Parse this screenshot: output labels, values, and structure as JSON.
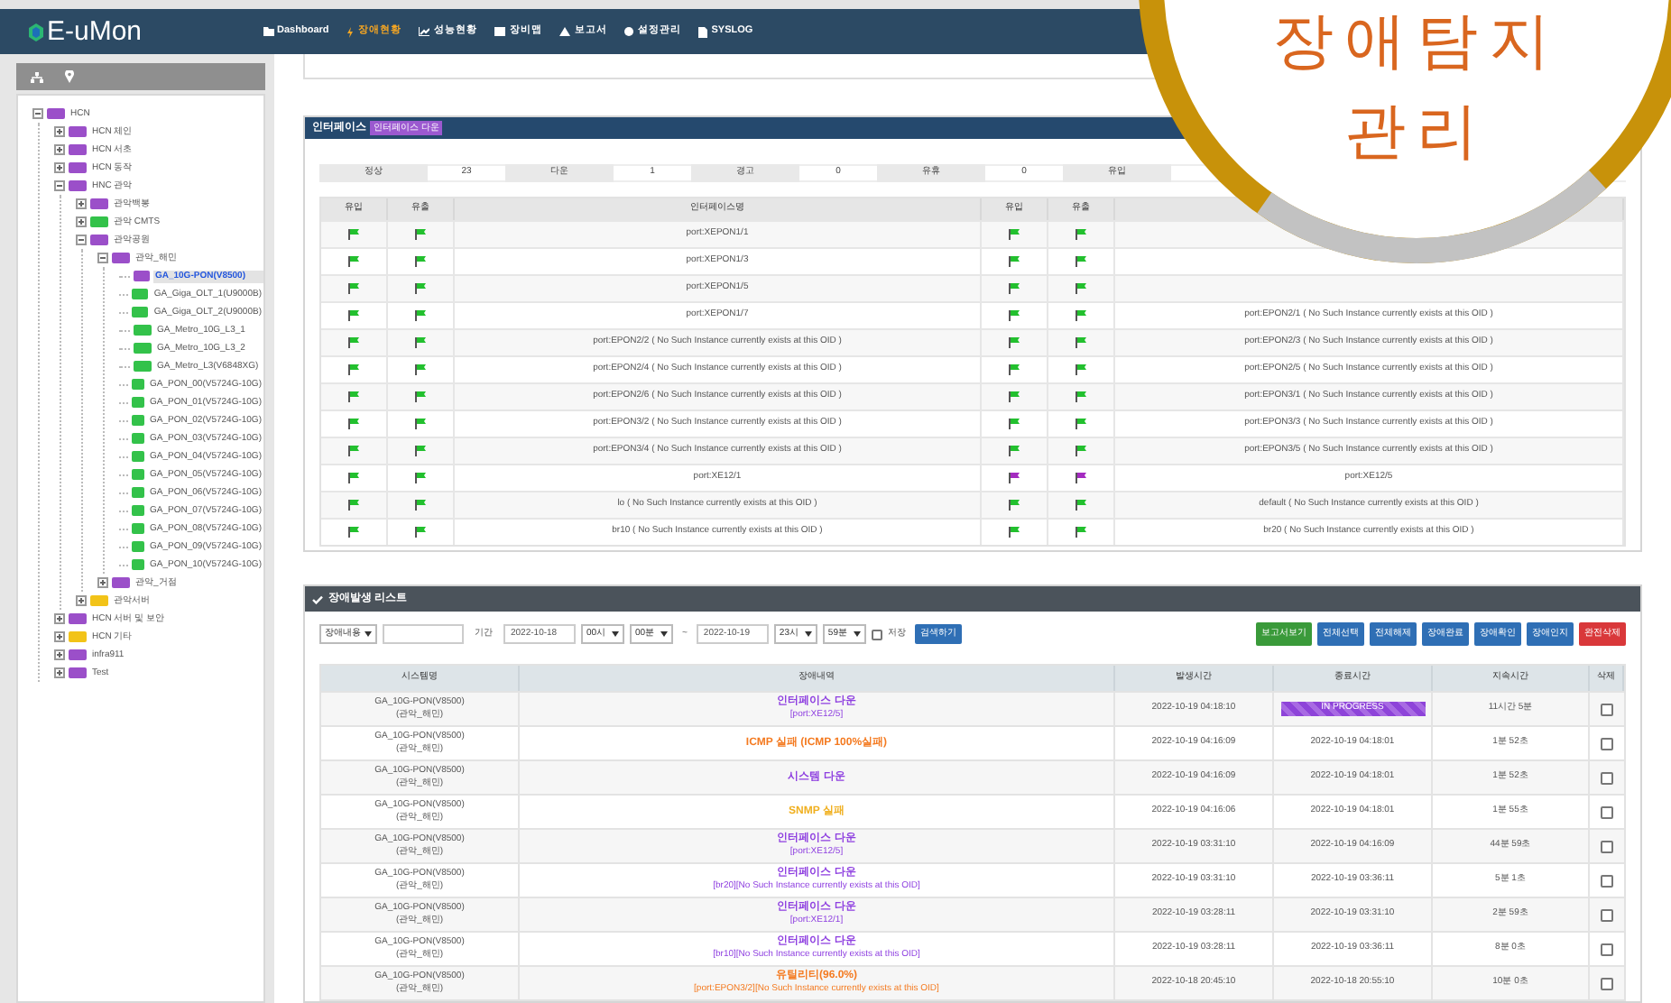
{
  "nav": {
    "logo": "E-uMon",
    "items": [
      {
        "label": "Dashboard",
        "selected": false
      },
      {
        "label": "장애현황",
        "selected": true
      },
      {
        "label": "성능현황",
        "selected": false
      },
      {
        "label": "장비맵",
        "selected": false
      },
      {
        "label": "보고서",
        "selected": false
      },
      {
        "label": "설정관리",
        "selected": false
      },
      {
        "label": "SYSLOG",
        "selected": false
      }
    ]
  },
  "callout": {
    "lines": [
      "장애탐지",
      "관리"
    ]
  },
  "tree": [
    {
      "label": "HCN",
      "color": "#9b4fc9",
      "expanded": true,
      "selected": false,
      "children": [
        {
          "label": "HCN 체인",
          "color": "#9b4fc9",
          "expanded": false,
          "selected": false
        },
        {
          "label": "HCN 서초",
          "color": "#9b4fc9",
          "expanded": false,
          "selected": false
        },
        {
          "label": "HCN 동작",
          "color": "#9b4fc9",
          "expanded": false,
          "selected": false
        },
        {
          "label": "HNC 관악",
          "color": "#9b4fc9",
          "expanded": true,
          "selected": false,
          "children": [
            {
              "label": "관악백봉",
              "color": "#9b4fc9",
              "expanded": false,
              "selected": false
            },
            {
              "label": "관악 CMTS",
              "color": "#33c24a",
              "expanded": false,
              "selected": false
            },
            {
              "label": "관악공원",
              "color": "#9b4fc9",
              "expanded": true,
              "selected": false,
              "children": [
                {
                  "label": "관악_해민",
                  "color": "#9b4fc9",
                  "expanded": true,
                  "selected": false,
                  "children": [
                    {
                      "label": "GA_10G-PON(V8500)",
                      "color": "#9b4fc9",
                      "selected": true
                    },
                    {
                      "label": "GA_Giga_OLT_1(U9000B)",
                      "color": "#33c24a",
                      "selected": false
                    },
                    {
                      "label": "GA_Giga_OLT_2(U9000B)",
                      "color": "#33c24a",
                      "selected": false
                    },
                    {
                      "label": "GA_Metro_10G_L3_1",
                      "color": "#33c24a",
                      "selected": false
                    },
                    {
                      "label": "GA_Metro_10G_L3_2",
                      "color": "#33c24a",
                      "selected": false
                    },
                    {
                      "label": "GA_Metro_L3(V6848XG)",
                      "color": "#33c24a",
                      "selected": false
                    },
                    {
                      "label": "GA_PON_00(V5724G-10G)",
                      "color": "#33c24a",
                      "selected": false
                    },
                    {
                      "label": "GA_PON_01(V5724G-10G)",
                      "color": "#33c24a",
                      "selected": false
                    },
                    {
                      "label": "GA_PON_02(V5724G-10G)",
                      "color": "#33c24a",
                      "selected": false
                    },
                    {
                      "label": "GA_PON_03(V5724G-10G)",
                      "color": "#33c24a",
                      "selected": false
                    },
                    {
                      "label": "GA_PON_04(V5724G-10G)",
                      "color": "#33c24a",
                      "selected": false
                    },
                    {
                      "label": "GA_PON_05(V5724G-10G)",
                      "color": "#33c24a",
                      "selected": false
                    },
                    {
                      "label": "GA_PON_06(V5724G-10G)",
                      "color": "#33c24a",
                      "selected": false
                    },
                    {
                      "label": "GA_PON_07(V5724G-10G)",
                      "color": "#33c24a",
                      "selected": false
                    },
                    {
                      "label": "GA_PON_08(V5724G-10G)",
                      "color": "#33c24a",
                      "selected": false
                    },
                    {
                      "label": "GA_PON_09(V5724G-10G)",
                      "color": "#33c24a",
                      "selected": false
                    },
                    {
                      "label": "GA_PON_10(V5724G-10G)",
                      "color": "#33c24a",
                      "selected": false
                    }
                  ]
                },
                {
                  "label": "관악_거점",
                  "color": "#9b4fc9",
                  "expanded": false,
                  "selected": false
                }
              ]
            },
            {
              "label": "관악서버",
              "color": "#f2c318",
              "expanded": false,
              "selected": false
            }
          ]
        },
        {
          "label": "HCN 서버 및 보안",
          "color": "#9b4fc9",
          "expanded": false,
          "selected": false
        },
        {
          "label": "HCN 기타",
          "color": "#f2c318",
          "expanded": false,
          "selected": false
        },
        {
          "label": "infra911",
          "color": "#9b4fc9",
          "expanded": false,
          "selected": false
        },
        {
          "label": "Test",
          "color": "#9b4fc9",
          "expanded": false,
          "selected": false
        }
      ]
    }
  ],
  "interfaces": {
    "title": "인터페이스",
    "badge": "인터페이스 다운",
    "summary": [
      {
        "label": "정상",
        "value": "23"
      },
      {
        "label": "다운",
        "value": "1"
      },
      {
        "label": "경고",
        "value": "0"
      },
      {
        "label": "유휴",
        "value": "0"
      },
      {
        "label": "유입"
      }
    ],
    "columns": [
      "유입",
      "유출",
      "인터페이스명",
      "유입",
      "유출"
    ],
    "rows": [
      {
        "in_ok": true,
        "out_ok": true,
        "name": "port:XEPON1/1",
        "in2_ok": true,
        "out2_ok": true
      },
      {
        "in_ok": true,
        "out_ok": true,
        "name": "port:XEPON1/3",
        "in2_ok": true,
        "out2_ok": true
      },
      {
        "in_ok": true,
        "out_ok": true,
        "name": "port:XEPON1/5",
        "in2_ok": true,
        "out2_ok": true
      },
      {
        "in_ok": true,
        "out_ok": true,
        "name": "port:XEPON1/7",
        "in2_ok": true,
        "out2_ok": true,
        "name2": "port:EPON2/1 ( No Such Instance currently exists at this OID )"
      },
      {
        "in_ok": true,
        "out_ok": true,
        "name": "port:EPON2/2 ( No Such Instance currently exists at this OID )",
        "in2_ok": true,
        "out2_ok": true,
        "name2": "port:EPON2/3 ( No Such Instance currently exists at this OID )"
      },
      {
        "in_ok": true,
        "out_ok": true,
        "name": "port:EPON2/4 ( No Such Instance currently exists at this OID )",
        "in2_ok": true,
        "out2_ok": true,
        "name2": "port:EPON2/5 ( No Such Instance currently exists at this OID )"
      },
      {
        "in_ok": true,
        "out_ok": true,
        "name": "port:EPON2/6 ( No Such Instance currently exists at this OID )",
        "in2_ok": true,
        "out2_ok": true,
        "name2": "port:EPON3/1 ( No Such Instance currently exists at this OID )"
      },
      {
        "in_ok": true,
        "out_ok": true,
        "name": "port:EPON3/2 ( No Such Instance currently exists at this OID )",
        "in2_ok": true,
        "out2_ok": true,
        "name2": "port:EPON3/3 ( No Such Instance currently exists at this OID )"
      },
      {
        "in_ok": true,
        "out_ok": true,
        "name": "port:EPON3/4 ( No Such Instance currently exists at this OID )",
        "in2_ok": true,
        "out2_ok": true,
        "name2": "port:EPON3/5 ( No Such Instance currently exists at this OID )"
      },
      {
        "in_ok": true,
        "out_ok": true,
        "name": "port:XE12/1",
        "in2_ok": false,
        "out2_ok": false,
        "name2": "port:XE12/5"
      },
      {
        "in_ok": true,
        "out_ok": true,
        "name": "lo ( No Such Instance currently exists at this OID )",
        "in2_ok": true,
        "out2_ok": true,
        "name2": "default ( No Such Instance currently exists at this OID )"
      },
      {
        "in_ok": true,
        "out_ok": true,
        "name": "br10 ( No Such Instance currently exists at this OID )",
        "in2_ok": true,
        "out2_ok": true,
        "name2": "br20 ( No Such Instance currently exists at this OID )"
      }
    ]
  },
  "faults": {
    "title": "장애발생 리스트",
    "filter": {
      "type_select": "장애내용",
      "period_label": "기간",
      "from_date": "2022-10-18",
      "from_hour": "00시",
      "from_min": "00분",
      "separator": "~",
      "to_date": "2022-10-19",
      "to_hour": "23시",
      "to_min": "59분",
      "save_label": "저장",
      "save_checked": false,
      "search_button": "검색하기"
    },
    "actions": [
      {
        "label": "보고서보기",
        "kind": "report"
      },
      {
        "label": "전체선택",
        "kind": "normal"
      },
      {
        "label": "전체해제",
        "kind": "normal"
      },
      {
        "label": "장애완료",
        "kind": "normal"
      },
      {
        "label": "장애확인",
        "kind": "normal"
      },
      {
        "label": "장애인지",
        "kind": "normal"
      },
      {
        "label": "완전삭제",
        "kind": "danger"
      }
    ],
    "columns": [
      "시스템명",
      "장애내역",
      "발생시간",
      "종료시간",
      "지속시간",
      "삭제"
    ],
    "rows": [
      {
        "system": "GA_10G-PON(V8500)",
        "group": "(관악_해민)",
        "title": "인터페이스 다운",
        "detail": "[port:XE12/5]",
        "color": "#8e3fe0",
        "start": "2022-10-19 04:18:10",
        "end": "IN PROGRESS",
        "in_progress": true,
        "duration": "11시간 5분",
        "checked": false
      },
      {
        "system": "GA_10G-PON(V8500)",
        "group": "(관악_해민)",
        "title": "ICMP 실패 (ICMP 100%실패)",
        "color": "#f47a20",
        "start": "2022-10-19 04:16:09",
        "end": "2022-10-19 04:18:01",
        "in_progress": false,
        "duration": "1분 52초",
        "checked": false
      },
      {
        "system": "GA_10G-PON(V8500)",
        "group": "(관악_해민)",
        "title": "시스템 다운",
        "color": "#8e3fe0",
        "start": "2022-10-19 04:16:09",
        "end": "2022-10-19 04:18:01",
        "in_progress": false,
        "duration": "1분 52초",
        "checked": false
      },
      {
        "system": "GA_10G-PON(V8500)",
        "group": "(관악_해민)",
        "title": "SNMP 실패",
        "color": "#f0b020",
        "start": "2022-10-19 04:16:06",
        "end": "2022-10-19 04:18:01",
        "in_progress": false,
        "duration": "1분 55초",
        "checked": false
      },
      {
        "system": "GA_10G-PON(V8500)",
        "group": "(관악_해민)",
        "title": "인터페이스 다운",
        "detail": "[port:XE12/5]",
        "color": "#8e3fe0",
        "start": "2022-10-19 03:31:10",
        "end": "2022-10-19 04:16:09",
        "in_progress": false,
        "duration": "44분 59초",
        "checked": false
      },
      {
        "system": "GA_10G-PON(V8500)",
        "group": "(관악_해민)",
        "title": "인터페이스 다운",
        "detail": "[br20][No Such Instance currently exists at this OID]",
        "color": "#8e3fe0",
        "start": "2022-10-19 03:31:10",
        "end": "2022-10-19 03:36:11",
        "in_progress": false,
        "duration": "5분 1초",
        "checked": false
      },
      {
        "system": "GA_10G-PON(V8500)",
        "group": "(관악_해민)",
        "title": "인터페이스 다운",
        "detail": "[port:XE12/1]",
        "color": "#8e3fe0",
        "start": "2022-10-19 03:28:11",
        "end": "2022-10-19 03:31:10",
        "in_progress": false,
        "duration": "2분 59초",
        "checked": false
      },
      {
        "system": "GA_10G-PON(V8500)",
        "group": "(관악_해민)",
        "title": "인터페이스 다운",
        "detail": "[br10][No Such Instance currently exists at this OID]",
        "color": "#8e3fe0",
        "start": "2022-10-19 03:28:11",
        "end": "2022-10-19 03:36:11",
        "in_progress": false,
        "duration": "8분 0초",
        "checked": false
      },
      {
        "system": "GA_10G-PON(V8500)",
        "group": "(관악_해민)",
        "title": "유틸리티(96.0%)",
        "detail": "[port:EPON3/2][No Such Instance currently exists at this OID]",
        "color": "#f47a20",
        "start": "2022-10-18 20:45:10",
        "end": "2022-10-18 20:55:10",
        "in_progress": false,
        "duration": "10분 0초",
        "checked": false
      }
    ]
  }
}
